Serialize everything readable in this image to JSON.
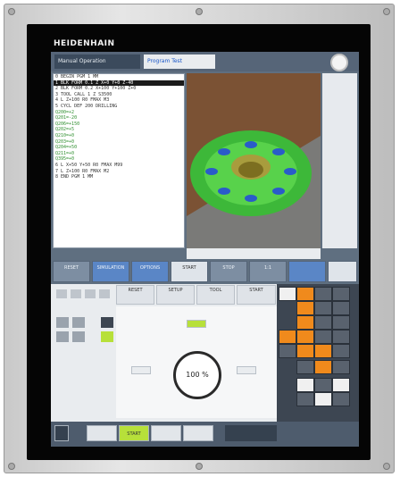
{
  "brand": "HEIDENHAIN",
  "tabs": [
    "Manual Operation",
    "Program Test"
  ],
  "program_lines": [
    "0 BEGIN PGM 1 MM",
    "1 BLK FORM 0.1 Z X+0 Y+0 Z-40",
    "2 BLK FORM 0.2 X+100 Y+100 Z+0",
    "3 TOOL CALL 1 Z S3500",
    "4 L Z+100 R0 FMAX M3",
    "5 CYCL DEF 200 DRILLING",
    "Q200=+2",
    "Q201=-20",
    "Q206=+150",
    "Q202=+5",
    "Q210=+0",
    "Q203=+0",
    "Q204=+50",
    "Q211=+0",
    "Q395=+0",
    "6 L X+50 Y+50 R0 FMAX M99",
    "7 L Z+100 R0 FMAX M2",
    "8 END PGM 1 MM"
  ],
  "softkeys": [
    "RESET",
    "SIMULATION",
    "OPTIONS",
    "START",
    "STOP",
    "1:1"
  ],
  "control_buttons": [
    "RESET",
    "SETUP",
    "TOOL",
    "START"
  ],
  "dial_value": "100 %",
  "bottom_buttons": [
    "",
    "START",
    "",
    "",
    ""
  ],
  "colors": {
    "accent_orange": "#f08a1c",
    "accent_green": "#b7e03a"
  }
}
